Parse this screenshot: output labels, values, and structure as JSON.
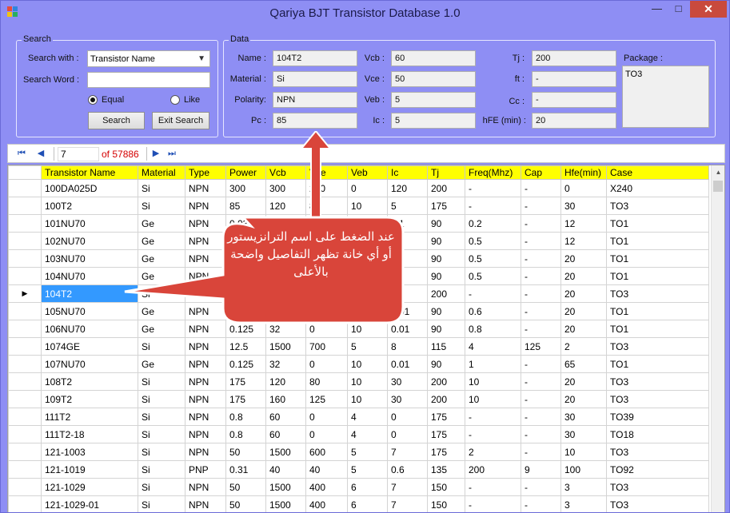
{
  "window": {
    "title": "Qariya BJT Transistor Database 1.0",
    "min": "—",
    "max": "□",
    "close": "✕"
  },
  "search": {
    "group_label": "Search",
    "search_with_label": "Search with :",
    "search_with_value": "Transistor Name",
    "search_word_label": "Search Word :",
    "search_word_value": "",
    "radio_equal": "Equal",
    "radio_like": "Like",
    "search_button": "Search",
    "exit_button": "Exit Search"
  },
  "data": {
    "group_label": "Data",
    "name_label": "Name :",
    "name": "104T2",
    "material_label": "Material :",
    "material": "Si",
    "polarity_label": "Polarity:",
    "polarity": "NPN",
    "pc_label": "Pc :",
    "pc": "85",
    "vcb_label": "Vcb :",
    "vcb": "60",
    "vce_label": "Vce :",
    "vce": "50",
    "veb_label": "Veb :",
    "veb": "5",
    "ic_label": "Ic :",
    "ic": "5",
    "tj_label": "Tj :",
    "tj": "200",
    "ft_label": "ft :",
    "ft": "-",
    "cc_label": "Cc :",
    "cc": "-",
    "hfe_label": "hFE (min) :",
    "hfe": "20",
    "package_label": "Package :",
    "package": "TO3"
  },
  "navigator": {
    "position": "7",
    "count": "of 57886",
    "first": "⏮",
    "prev": "◀",
    "next": "▶",
    "last": "⏭"
  },
  "table": {
    "columns": [
      "Transistor Name",
      "Material",
      "Type",
      "Power",
      "Vcb",
      "Vce",
      "Veb",
      "Ic",
      "Tj",
      "Freq(Mhz)",
      "Cap",
      "Hfe(min)",
      "Case"
    ],
    "rows": [
      [
        "100DA025D",
        "Si",
        "NPN",
        "300",
        "300",
        "250",
        "0",
        "120",
        "200",
        "-",
        "-",
        "0",
        "X240"
      ],
      [
        "100T2",
        "Si",
        "NPN",
        "85",
        "120",
        "80",
        "10",
        "5",
        "175",
        "-",
        "-",
        "30",
        "TO3"
      ],
      [
        "101NU70",
        "Ge",
        "NPN",
        "0.03",
        "10",
        "",
        "",
        "0.1",
        "90",
        "0.2",
        "-",
        "12",
        "TO1"
      ],
      [
        "102NU70",
        "Ge",
        "NPN",
        "",
        "",
        "",
        "",
        "0.1",
        "90",
        "0.5",
        "-",
        "12",
        "TO1"
      ],
      [
        "103NU70",
        "Ge",
        "NPN",
        "",
        "",
        "",
        "",
        "0.1",
        "90",
        "0.5",
        "-",
        "20",
        "TO1"
      ],
      [
        "104NU70",
        "Ge",
        "NPN",
        "",
        "",
        "",
        "",
        "0.1",
        "90",
        "0.5",
        "-",
        "20",
        "TO1"
      ],
      [
        "104T2",
        "Si",
        "NPN",
        "",
        "",
        "",
        "",
        "",
        "200",
        "-",
        "-",
        "20",
        "TO3"
      ],
      [
        "105NU70",
        "Ge",
        "NPN",
        "",
        "",
        "",
        "",
        "0.01",
        "90",
        "0.6",
        "-",
        "20",
        "TO1"
      ],
      [
        "106NU70",
        "Ge",
        "NPN",
        "0.125",
        "32",
        "0",
        "10",
        "0.01",
        "90",
        "0.8",
        "-",
        "20",
        "TO1"
      ],
      [
        "1074GE",
        "Si",
        "NPN",
        "12.5",
        "1500",
        "700",
        "5",
        "8",
        "115",
        "4",
        "125",
        "2",
        "TO3"
      ],
      [
        "107NU70",
        "Ge",
        "NPN",
        "0.125",
        "32",
        "0",
        "10",
        "0.01",
        "90",
        "1",
        "-",
        "65",
        "TO1"
      ],
      [
        "108T2",
        "Si",
        "NPN",
        "175",
        "120",
        "80",
        "10",
        "30",
        "200",
        "10",
        "-",
        "20",
        "TO3"
      ],
      [
        "109T2",
        "Si",
        "NPN",
        "175",
        "160",
        "125",
        "10",
        "30",
        "200",
        "10",
        "-",
        "20",
        "TO3"
      ],
      [
        "111T2",
        "Si",
        "NPN",
        "0.8",
        "60",
        "0",
        "4",
        "0",
        "175",
        "-",
        "-",
        "30",
        "TO39"
      ],
      [
        "111T2-18",
        "Si",
        "NPN",
        "0.8",
        "60",
        "0",
        "4",
        "0",
        "175",
        "-",
        "-",
        "30",
        "TO18"
      ],
      [
        "121-1003",
        "Si",
        "NPN",
        "50",
        "1500",
        "600",
        "5",
        "7",
        "175",
        "2",
        "-",
        "10",
        "TO3"
      ],
      [
        "121-1019",
        "Si",
        "PNP",
        "0.31",
        "40",
        "40",
        "5",
        "0.6",
        "135",
        "200",
        "9",
        "100",
        "TO92"
      ],
      [
        "121-1029",
        "Si",
        "NPN",
        "50",
        "1500",
        "400",
        "6",
        "7",
        "150",
        "-",
        "-",
        "3",
        "TO3"
      ],
      [
        "121-1029-01",
        "Si",
        "NPN",
        "50",
        "1500",
        "400",
        "6",
        "7",
        "150",
        "-",
        "-",
        "3",
        "TO3"
      ]
    ],
    "selected_row": 6
  },
  "callout": {
    "text": "عند الضغط على اسم الترانزيستور أو أي خانة تظهر التفاصيل واضحة بالأعلى"
  },
  "colors": {
    "window": "#8e8ef4",
    "header": "#ffff00",
    "selection": "#3399ff",
    "callout": "#d9453a",
    "close": "#c94a3d"
  }
}
